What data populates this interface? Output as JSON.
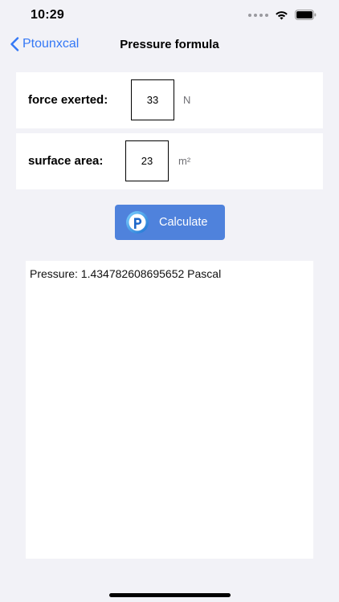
{
  "status_bar": {
    "time": "10:29",
    "icons": [
      "signal-icon",
      "wifi-icon",
      "battery-icon"
    ]
  },
  "nav": {
    "back_label": "Ptounxcal",
    "title": "Pressure formula",
    "accent_color": "#3478f6"
  },
  "form": {
    "force": {
      "label": "force exerted:",
      "value": "33",
      "unit": "N"
    },
    "area": {
      "label": "surface area:",
      "value": "23",
      "unit": "m²"
    }
  },
  "calculate_button": {
    "label": "Calculate",
    "icon": "p-logo-icon",
    "color": "#4f82dc"
  },
  "result": {
    "text": "Pressure: 1.434782608695652 Pascal"
  }
}
